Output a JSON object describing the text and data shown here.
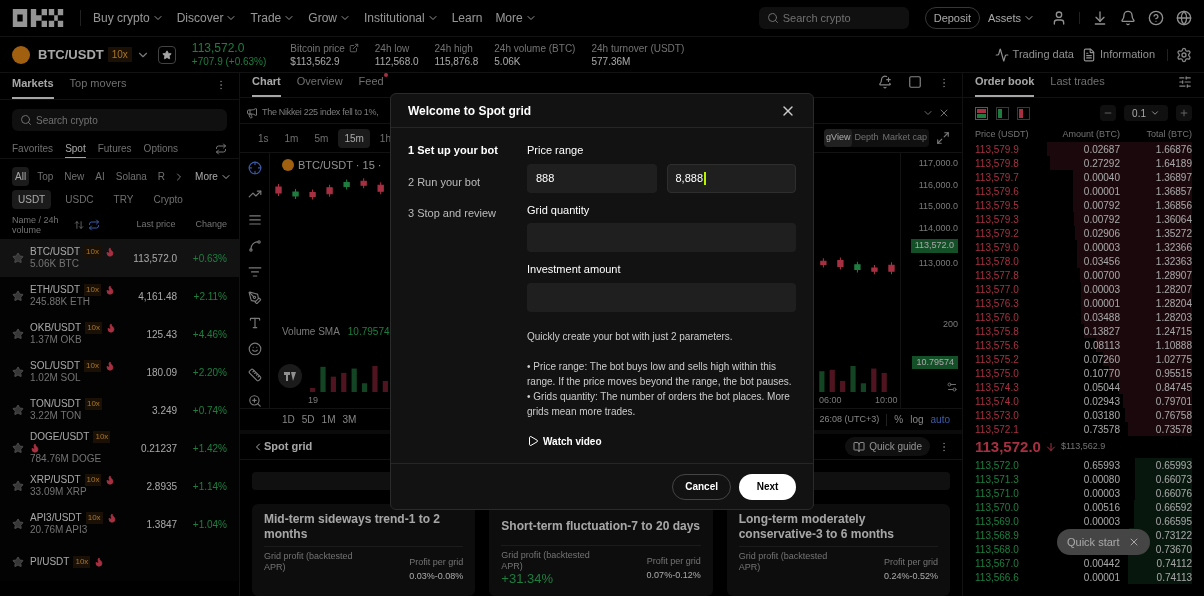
{
  "nav": {
    "menu": [
      {
        "label": "Buy crypto",
        "dropdown": true
      },
      {
        "label": "Discover",
        "dropdown": true
      },
      {
        "label": "Trade",
        "dropdown": true
      },
      {
        "label": "Grow",
        "dropdown": true
      },
      {
        "label": "Institutional",
        "dropdown": true
      },
      {
        "label": "Learn",
        "dropdown": false
      },
      {
        "label": "More",
        "dropdown": true
      }
    ],
    "search": {
      "placeholder": "Search crypto"
    },
    "deposit": "Deposit",
    "assets": "Assets"
  },
  "ticker": {
    "pair": "BTC/USDT",
    "leverage": "10x",
    "price": "113,572.0",
    "change": "+707.9 (+0.63%)",
    "stats": [
      {
        "label": "Bitcoin price",
        "value": "$113,562.9",
        "link": true
      },
      {
        "label": "24h low",
        "value": "112,568.0",
        "link": false
      },
      {
        "label": "24h high",
        "value": "115,876.8",
        "link": false
      },
      {
        "label": "24h volume (BTC)",
        "value": "5.06K",
        "link": false
      },
      {
        "label": "24h turnover (USDT)",
        "value": "577.36M",
        "link": false
      }
    ],
    "links": [
      {
        "label": "Trading data",
        "kind": "pulse"
      },
      {
        "label": "Information",
        "kind": "doc"
      }
    ]
  },
  "markets": {
    "tabs": [
      {
        "label": "Markets",
        "selected": true
      },
      {
        "label": "Top movers",
        "selected": false
      }
    ],
    "search": {
      "placeholder": "Search crypto"
    },
    "types": [
      {
        "label": "Favorites",
        "selected": false
      },
      {
        "label": "Spot",
        "selected": true
      },
      {
        "label": "Futures",
        "selected": false
      },
      {
        "label": "Options",
        "selected": false
      }
    ],
    "categories": [
      {
        "label": "All",
        "selected": true
      },
      {
        "label": "Top",
        "selected": false
      },
      {
        "label": "New",
        "selected": false
      },
      {
        "label": "AI",
        "selected": false
      },
      {
        "label": "Solana",
        "selected": false
      },
      {
        "label": "R",
        "selected": false
      }
    ],
    "more": "More",
    "quotes": [
      {
        "label": "USDT",
        "selected": true
      },
      {
        "label": "USDC",
        "selected": false
      },
      {
        "label": "TRY",
        "selected": false
      },
      {
        "label": "Crypto",
        "selected": false
      }
    ],
    "columns": [
      "Name / 24h volume",
      "Last price",
      "Change"
    ],
    "rows": [
      {
        "pair": "BTC/USDT",
        "leverage": "10x",
        "hot": true,
        "volume": "5.06K BTC",
        "price": "113,572.0",
        "change": "+0.63%",
        "selected": true
      },
      {
        "pair": "ETH/USDT",
        "leverage": "10x",
        "hot": true,
        "volume": "245.88K ETH",
        "price": "4,161.48",
        "change": "+2.11%",
        "selected": false
      },
      {
        "pair": "OKB/USDT",
        "leverage": "10x",
        "hot": true,
        "volume": "1.37M OKB",
        "price": "125.43",
        "change": "+4.46%",
        "selected": false
      },
      {
        "pair": "SOL/USDT",
        "leverage": "10x",
        "hot": true,
        "volume": "1.02M SOL",
        "price": "180.09",
        "change": "+2.20%",
        "selected": false
      },
      {
        "pair": "TON/USDT",
        "leverage": "10x",
        "hot": false,
        "volume": "3.22M TON",
        "price": "3.249",
        "change": "+0.74%",
        "selected": false
      },
      {
        "pair": "DOGE/USDT",
        "leverage": "10x",
        "hot": true,
        "volume": "784.76M DOGE",
        "price": "0.21237",
        "change": "+1.42%",
        "selected": false
      },
      {
        "pair": "XRP/USDT",
        "leverage": "10x",
        "hot": true,
        "volume": "33.09M XRP",
        "price": "2.8935",
        "change": "+1.14%",
        "selected": false
      },
      {
        "pair": "API3/USDT",
        "leverage": "10x",
        "hot": true,
        "volume": "20.76M API3",
        "price": "1.3847",
        "change": "+1.04%",
        "selected": false
      },
      {
        "pair": "PI/USDT",
        "leverage": "10x",
        "hot": true,
        "selected": false
      }
    ]
  },
  "chart": {
    "tabs": [
      {
        "label": "Chart",
        "selected": true,
        "notify": false
      },
      {
        "label": "Overview",
        "selected": false,
        "notify": false
      },
      {
        "label": "Feed",
        "selected": false,
        "notify": true
      }
    ],
    "news": "The Nikkei 225 index fell to 1%,",
    "timeframes": [
      {
        "label": "1s",
        "selected": false
      },
      {
        "label": "1m",
        "selected": false
      },
      {
        "label": "5m",
        "selected": false
      },
      {
        "label": "15m",
        "selected": true
      },
      {
        "label": "1h",
        "selected": false
      }
    ],
    "views": [
      {
        "label": "gView",
        "selected": true
      },
      {
        "label": "Depth",
        "selected": false
      },
      {
        "label": "Market cap",
        "selected": false
      }
    ],
    "legend": "BTC/USDT · 15 ·",
    "volume_label": "Volume SMA",
    "volume_value": "10.79574",
    "price_axis": [
      "117,000.0",
      "116,000.0",
      "115,000.0",
      "114,000.0",
      "113,000.0"
    ],
    "last_price": "113,572.0",
    "volume_axis": "200",
    "volume_last": "10.79574",
    "time_axis": [
      "19",
      "06:00",
      "10:00"
    ],
    "ranges": [
      "1D",
      "5D",
      "1M",
      "3M"
    ],
    "time": "26:08 (UTC+3)",
    "scales": [
      {
        "label": "%",
        "active": false
      },
      {
        "label": "log",
        "active": false
      },
      {
        "label": "auto",
        "active": true
      }
    ]
  },
  "spot_grid": {
    "title": "Spot grid",
    "guide": "Quick guide",
    "cards": [
      {
        "title": "Mid-term sideways trend-1 to 2 months",
        "profit_label": "Grid profit (backtested APR)",
        "per_grid_label": "Profit per grid",
        "per_grid": "0.03%-0.08%"
      },
      {
        "title": "Short-term fluctuation-7 to 20 days",
        "profit_label": "Grid profit (backtested APR)",
        "apr": "+31.34%",
        "per_grid_label": "Profit per grid",
        "per_grid": "0.07%-0.12%"
      },
      {
        "title": "Long-term moderately conservative-3 to 6 months",
        "profit_label": "Grid profit (backtested APR)",
        "per_grid_label": "Profit per grid",
        "per_grid": "0.24%-0.52%"
      }
    ]
  },
  "order_book": {
    "tabs": [
      {
        "label": "Order book",
        "selected": true
      },
      {
        "label": "Last trades",
        "selected": false
      }
    ],
    "step": "0.1",
    "columns": [
      "Price (USDT)",
      "Amount (BTC)",
      "Total (BTC)"
    ],
    "asks": [
      {
        "price": "113,579.9",
        "amount": "0.02687",
        "total": "1.66876"
      },
      {
        "price": "113,579.8",
        "amount": "0.27292",
        "total": "1.64189"
      },
      {
        "price": "113,579.7",
        "amount": "0.00040",
        "total": "1.36897"
      },
      {
        "price": "113,579.6",
        "amount": "0.00001",
        "total": "1.36857"
      },
      {
        "price": "113,579.5",
        "amount": "0.00792",
        "total": "1.36856"
      },
      {
        "price": "113,579.3",
        "amount": "0.00792",
        "total": "1.36064"
      },
      {
        "price": "113,579.2",
        "amount": "0.02906",
        "total": "1.35272"
      },
      {
        "price": "113,579.0",
        "amount": "0.00003",
        "total": "1.32366"
      },
      {
        "price": "113,578.0",
        "amount": "0.03456",
        "total": "1.32363"
      },
      {
        "price": "113,577.8",
        "amount": "0.00700",
        "total": "1.28907"
      },
      {
        "price": "113,577.0",
        "amount": "0.00003",
        "total": "1.28207"
      },
      {
        "price": "113,576.3",
        "amount": "0.00001",
        "total": "1.28204"
      },
      {
        "price": "113,576.0",
        "amount": "0.03488",
        "total": "1.28203"
      },
      {
        "price": "113,575.8",
        "amount": "0.13827",
        "total": "1.24715"
      },
      {
        "price": "113,575.6",
        "amount": "0.08113",
        "total": "1.10888"
      },
      {
        "price": "113,575.2",
        "amount": "0.07260",
        "total": "1.02775"
      },
      {
        "price": "113,575.0",
        "amount": "0.10770",
        "total": "0.95515"
      },
      {
        "price": "113,574.3",
        "amount": "0.05044",
        "total": "0.84745"
      },
      {
        "price": "113,574.0",
        "amount": "0.02943",
        "total": "0.79701"
      },
      {
        "price": "113,573.0",
        "amount": "0.03180",
        "total": "0.76758"
      },
      {
        "price": "113,572.1",
        "amount": "0.73578",
        "total": "0.73578"
      }
    ],
    "mid": {
      "price": "113,572.0",
      "usd": "$113,562.9"
    },
    "bids": [
      {
        "price": "113,572.0",
        "amount": "0.65993",
        "total": "0.65993"
      },
      {
        "price": "113,571.3",
        "amount": "0.00080",
        "total": "0.66073"
      },
      {
        "price": "113,571.0",
        "amount": "0.00003",
        "total": "0.66076"
      },
      {
        "price": "113,570.0",
        "amount": "0.00516",
        "total": "0.66592"
      },
      {
        "price": "113,569.0",
        "amount": "0.00003",
        "total": "0.66595"
      },
      {
        "price": "113,568.9",
        "total": "0.73122"
      },
      {
        "price": "113,568.0",
        "total": "0.73670"
      },
      {
        "price": "113,567.0",
        "amount": "0.00442",
        "total": "0.74112"
      },
      {
        "price": "113,566.6",
        "amount": "0.00001",
        "total": "0.74113"
      }
    ]
  },
  "toast": {
    "label": "Quick start"
  },
  "modal": {
    "title": "Welcome to Spot grid",
    "steps": [
      {
        "label": "1 Set up your bot",
        "selected": true
      },
      {
        "label": "2 Run your bot",
        "selected": false
      },
      {
        "label": "3 Stop and review",
        "selected": false
      }
    ],
    "price_label": "Price range",
    "min_price": {
      "value": "888",
      "focused": false
    },
    "max_price": {
      "value": "8,888",
      "focused": true
    },
    "grid_label": "Grid quantity",
    "investment_label": "Investment amount",
    "intro": "Quickly create your bot with just 2 parameters.",
    "bullets": [
      "• Price range: The bot buys low and sells high within this range. If the price moves beyond the range, the bot pauses.",
      "• Grids quantity: The number of orders the bot places. More grids mean more trades."
    ],
    "video": "Watch video",
    "cancel": "Cancel",
    "next": "Next"
  }
}
